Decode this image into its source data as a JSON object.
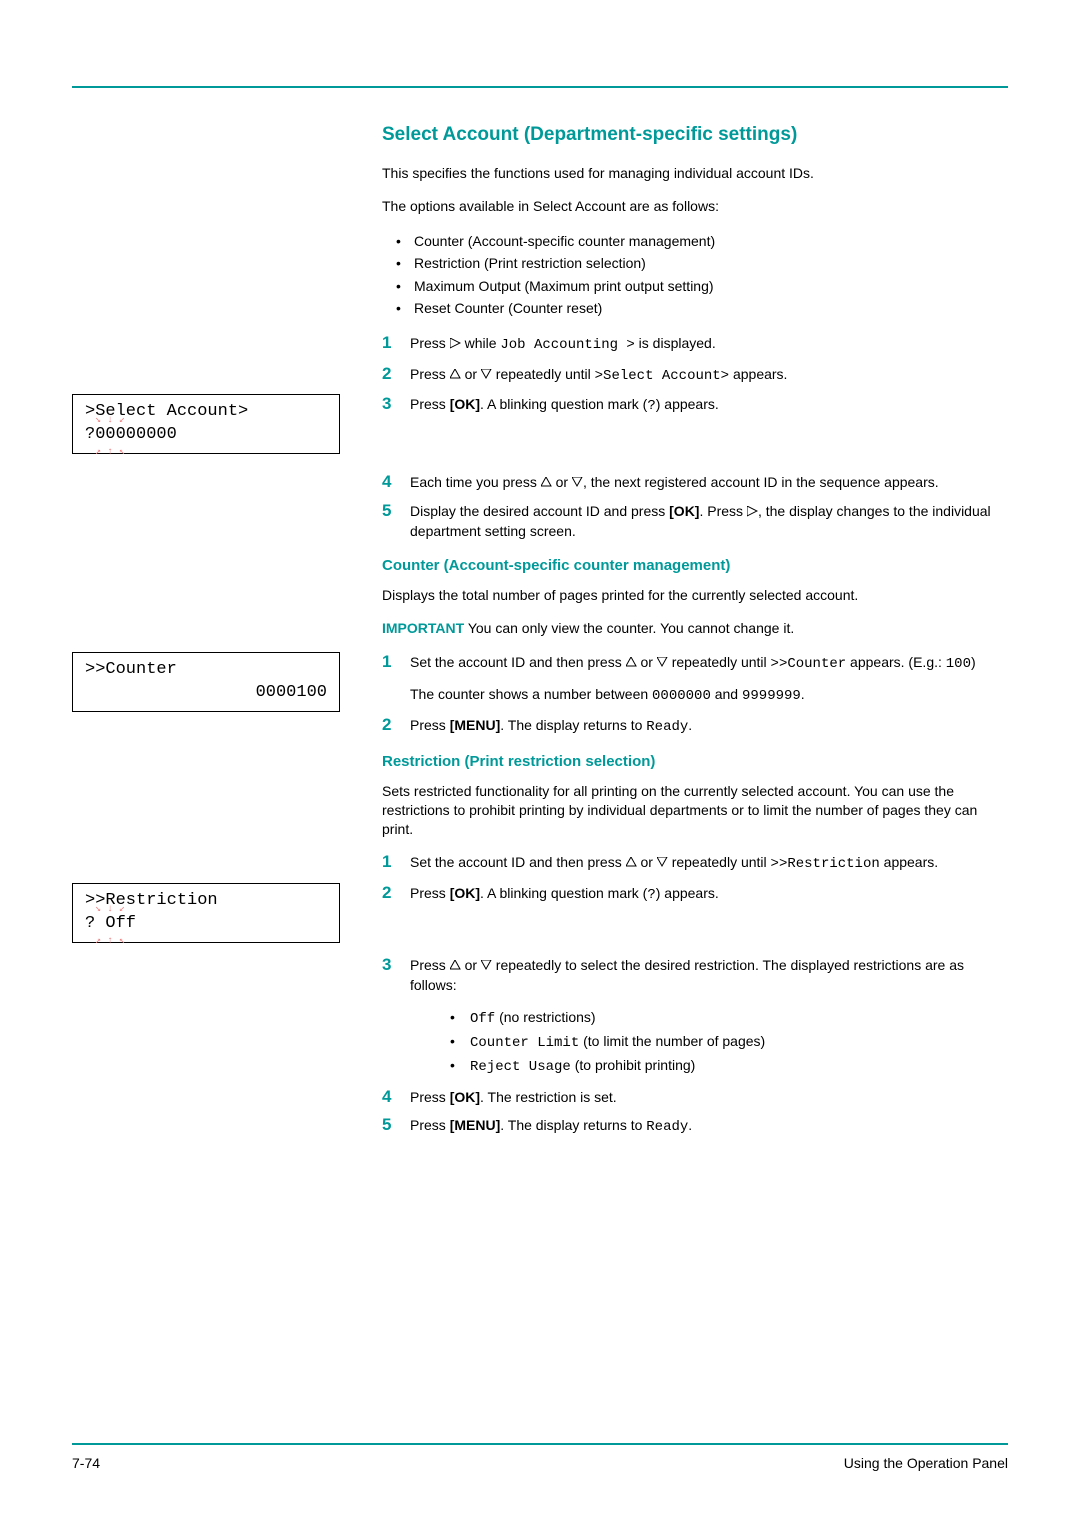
{
  "title": "Select Account (Department-specific settings)",
  "intro1": "This specifies the functions used for managing individual account IDs.",
  "intro2": "The options available in Select Account are as follows:",
  "options": [
    "Counter (Account-specific counter management)",
    "Restriction (Print restriction selection)",
    "Maximum Output (Maximum print output setting)",
    "Reset Counter (Counter reset)"
  ],
  "steps1": {
    "s1": {
      "pre": "Press ",
      "mono": "Job Accounting >",
      "post": " is displayed.",
      "mid": " while "
    },
    "s2": {
      "pre": "Press ",
      "mid": " repeatedly until ",
      "mono": ">Select Account>",
      "post": " appears."
    },
    "s3": {
      "pre": "Press ",
      "bold": "[OK]",
      "post": ". A blinking question mark (",
      "mono": "?",
      "tail": ") appears."
    },
    "s4": {
      "pre": "Each time you press ",
      "post": ", the next registered account ID in the sequence appears."
    },
    "s5": {
      "pre": "Display the desired account ID and press ",
      "bold": "[OK]",
      "mid": ". Press ",
      "post": ", the display changes to the individual department setting screen."
    }
  },
  "lcd1": {
    "line1": ">Select Account>",
    "line2a": "?",
    "line2b": "00000000"
  },
  "counter": {
    "heading": "Counter (Account-specific counter management)",
    "para": "Displays the total number of pages printed for the currently selected account.",
    "important_label": "IMPORTANT",
    "important_text": "  You can only view the counter. You cannot change it.",
    "s1a": "Set the account ID and then press ",
    "s1b": " repeatedly until ",
    "s1m1": ">>Counter",
    "s1c": " appears. (E.g.: ",
    "s1m2": "100",
    "s1d": ")",
    "s1e": "The counter shows a number between ",
    "s1m3": "0000000",
    "s1f": " and ",
    "s1m4": "9999999",
    "s1g": ".",
    "s2a": "Press ",
    "s2b": "[MENU]",
    "s2c": ". The display returns to ",
    "s2m": "Ready",
    "s2d": "."
  },
  "lcd2": {
    "line1": ">>Counter",
    "line2": "0000100"
  },
  "restriction": {
    "heading": "Restriction (Print restriction selection)",
    "para": "Sets restricted functionality for all printing on the currently selected account. You can use the restrictions to prohibit printing by individual departments or to limit the number of pages they can print.",
    "s1a": "Set the account ID and then press ",
    "s1b": " repeatedly until ",
    "s1m": ">>Restriction",
    "s1c": " appears.",
    "s2a": "Press ",
    "s2b": "[OK]",
    "s2c": ". A blinking question mark (",
    "s2m": "?",
    "s2d": ") appears.",
    "s3a": "Press ",
    "s3b": " repeatedly to select the desired restriction. The displayed restrictions are as follows:",
    "opts": [
      {
        "mono": "Off",
        "text": " (no restrictions)"
      },
      {
        "mono": "Counter Limit",
        "text": " (to limit the number of pages)"
      },
      {
        "mono": "Reject Usage",
        "text": " (to prohibit printing)"
      }
    ],
    "s4a": "Press ",
    "s4b": "[OK]",
    "s4c": ". The restriction is set.",
    "s5a": "Press ",
    "s5b": "[MENU]",
    "s5c": ". The display returns to ",
    "s5m": "Ready",
    "s5d": "."
  },
  "lcd3": {
    "line1": ">>Restriction",
    "line2a": "?",
    "line2b": " Off"
  },
  "footer": {
    "page": "7-74",
    "section": "Using the Operation Panel"
  }
}
